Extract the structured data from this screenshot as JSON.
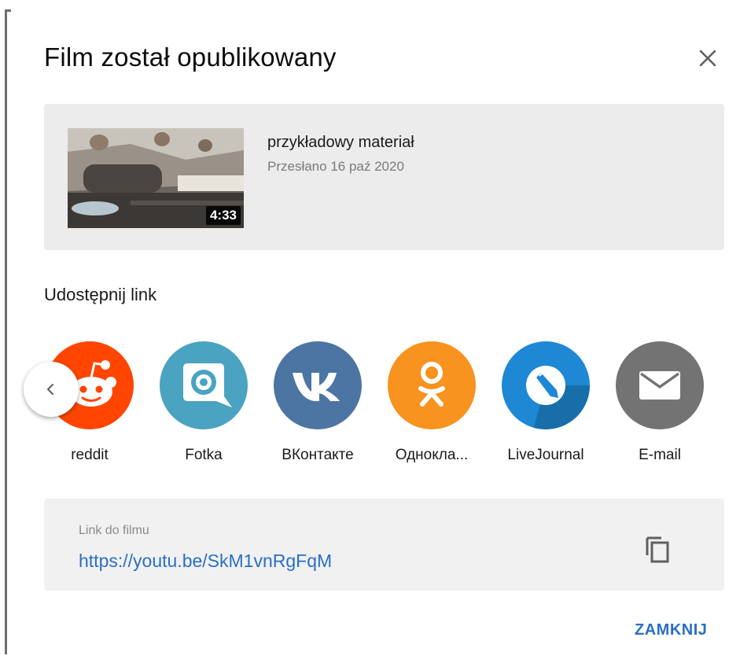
{
  "dialog": {
    "title": "Film został opublikowany",
    "close_icon": "close-icon"
  },
  "video": {
    "title": "przykładowy materiał",
    "uploaded": "Przesłano 16 paź 2020",
    "duration": "4:33"
  },
  "share": {
    "heading": "Udostępnij link",
    "prev_icon": "chevron-left-icon",
    "items": [
      {
        "label": "reddit",
        "icon": "reddit-icon",
        "color": "#ff4500"
      },
      {
        "label": "Fotka",
        "icon": "fotka-icon",
        "color": "#4aa3c0"
      },
      {
        "label": "ВКонтакте",
        "icon": "vk-icon",
        "color": "#4c75a3"
      },
      {
        "label": "Однокла...",
        "icon": "odnoklassniki-icon",
        "color": "#f7931e"
      },
      {
        "label": "LiveJournal",
        "icon": "livejournal-icon",
        "color": "#1e88d4"
      },
      {
        "label": "E-mail",
        "icon": "email-icon",
        "color": "#737373"
      }
    ]
  },
  "link": {
    "caption": "Link do filmu",
    "url": "https://youtu.be/SkM1vnRgFqM",
    "copy_icon": "copy-icon"
  },
  "actions": {
    "close_label": "ZAMKNIJ"
  },
  "colors": {
    "accent": "#2a6fc4",
    "card_bg": "#ececec"
  }
}
